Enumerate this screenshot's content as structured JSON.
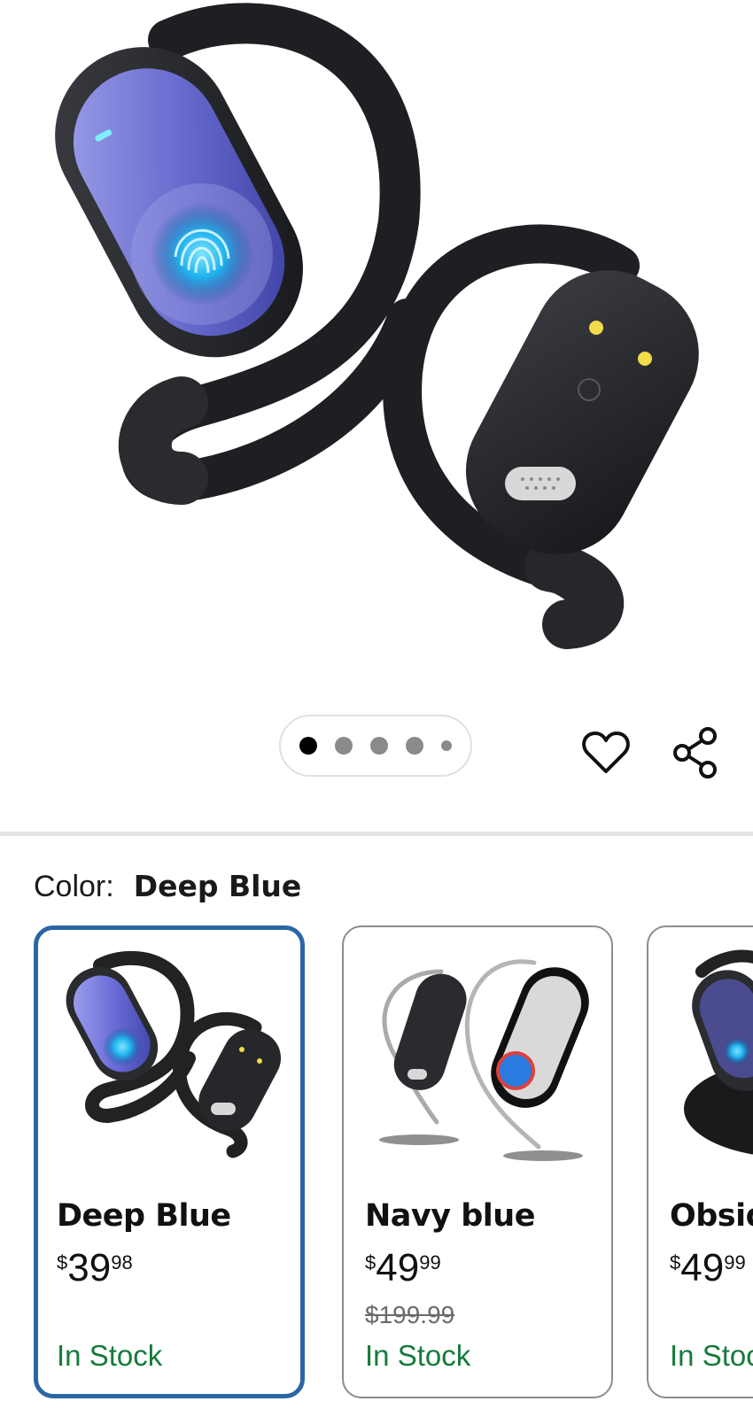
{
  "product": {
    "image_alt": "Open-ear wireless earbuds with ear hooks",
    "carousel": {
      "total_images": 5,
      "current_index": 1
    },
    "actions": {
      "favorite_icon": "heart-icon",
      "share_icon": "share-icon"
    }
  },
  "color_selector": {
    "label": "Color:",
    "selected_value": "Deep Blue",
    "options": [
      {
        "name": "Deep Blue",
        "currency": "$",
        "price_whole": "39",
        "price_cents": "98",
        "was_price": "",
        "stock": "In Stock",
        "selected": true
      },
      {
        "name": "Navy blue",
        "currency": "$",
        "price_whole": "49",
        "price_cents": "99",
        "was_price": "$199.99",
        "stock": "In Stock",
        "selected": false
      },
      {
        "name": "Obsidian",
        "currency": "$",
        "price_whole": "49",
        "price_cents": "99",
        "was_price": "",
        "stock": "In Stock",
        "selected": false
      }
    ]
  },
  "colors": {
    "selected_border": "#2b66a3",
    "stock_green": "#157a3c",
    "divider": "#e3e5e7"
  }
}
